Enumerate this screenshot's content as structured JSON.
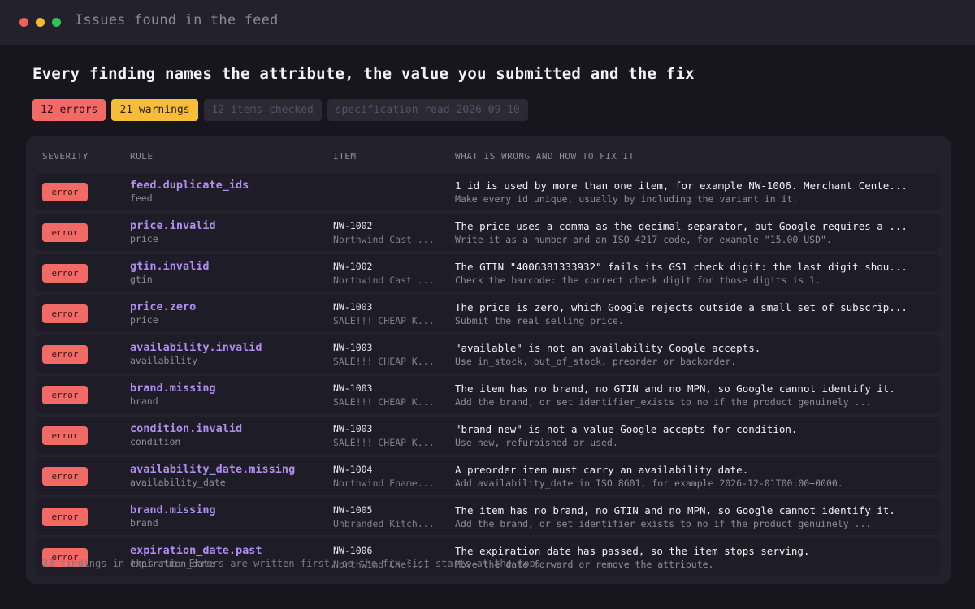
{
  "window": {
    "title": "Issues found in the feed",
    "controls": [
      "close",
      "minimize",
      "maximize"
    ]
  },
  "heading": "Every finding names the attribute, the value you submitted and the fix",
  "badges": [
    {
      "label": "12 errors",
      "kind": "error"
    },
    {
      "label": "21 warnings",
      "kind": "warning"
    },
    {
      "label": "12 items checked",
      "kind": "muted"
    },
    {
      "label": "specification read 2026-09-10",
      "kind": "muted"
    }
  ],
  "table": {
    "columns": [
      "SEVERITY",
      "RULE",
      "ITEM",
      "WHAT IS WRONG AND HOW TO FIX IT"
    ],
    "rows": [
      {
        "severity": "error",
        "rule": "feed.duplicate_ids",
        "attribute": "feed",
        "item_id": "",
        "item_name": "",
        "problem": "1 id is used by more than one item, for example NW-1006. Merchant Cente...",
        "fix": "Make every id unique, usually by including the variant in it."
      },
      {
        "severity": "error",
        "rule": "price.invalid",
        "attribute": "price",
        "item_id": "NW-1002",
        "item_name": "Northwind Cast ...",
        "problem": "The price uses a comma as the decimal separator, but Google requires a ...",
        "fix": "Write it as a number and an ISO 4217 code, for example \"15.00 USD\"."
      },
      {
        "severity": "error",
        "rule": "gtin.invalid",
        "attribute": "gtin",
        "item_id": "NW-1002",
        "item_name": "Northwind Cast ...",
        "problem": "The GTIN \"4006381333932\" fails its GS1 check digit: the last digit shou...",
        "fix": "Check the barcode: the correct check digit for those digits is 1."
      },
      {
        "severity": "error",
        "rule": "price.zero",
        "attribute": "price",
        "item_id": "NW-1003",
        "item_name": "SALE!!! CHEAP K...",
        "problem": "The price is zero, which Google rejects outside a small set of subscrip...",
        "fix": "Submit the real selling price."
      },
      {
        "severity": "error",
        "rule": "availability.invalid",
        "attribute": "availability",
        "item_id": "NW-1003",
        "item_name": "SALE!!! CHEAP K...",
        "problem": "\"available\" is not an availability Google accepts.",
        "fix": "Use in_stock, out_of_stock, preorder or backorder."
      },
      {
        "severity": "error",
        "rule": "brand.missing",
        "attribute": "brand",
        "item_id": "NW-1003",
        "item_name": "SALE!!! CHEAP K...",
        "problem": "The item has no brand, no GTIN and no MPN, so Google cannot identify it.",
        "fix": "Add the brand, or set identifier_exists to no if the product genuinely ..."
      },
      {
        "severity": "error",
        "rule": "condition.invalid",
        "attribute": "condition",
        "item_id": "NW-1003",
        "item_name": "SALE!!! CHEAP K...",
        "problem": "\"brand new\" is not a value Google accepts for condition.",
        "fix": "Use new, refurbished or used."
      },
      {
        "severity": "error",
        "rule": "availability_date.missing",
        "attribute": "availability_date",
        "item_id": "NW-1004",
        "item_name": "Northwind Ename...",
        "problem": "A preorder item must carry an availability date.",
        "fix": "Add availability_date in ISO 8601, for example 2026-12-01T00:00+0000."
      },
      {
        "severity": "error",
        "rule": "brand.missing",
        "attribute": "brand",
        "item_id": "NW-1005",
        "item_name": "Unbranded Kitch...",
        "problem": "The item has no brand, no GTIN and no MPN, so Google cannot identify it.",
        "fix": "Add the brand, or set identifier_exists to no if the product genuinely ..."
      },
      {
        "severity": "error",
        "rule": "expiration_date.past",
        "attribute": "expiration_date",
        "item_id": "NW-1006",
        "item_name": "Northwind Chef...",
        "problem": "The expiration date has passed, so the item stops serving.",
        "fix": "Move the date forward or remove the attribute."
      }
    ]
  },
  "footnote": "33 findings in this run. Errors are written first, so the fix list starts at the top.",
  "colors": {
    "error": "#f26a66",
    "warning": "#f6bd3b",
    "rule": "#b08ef0",
    "background": "#17161f"
  }
}
